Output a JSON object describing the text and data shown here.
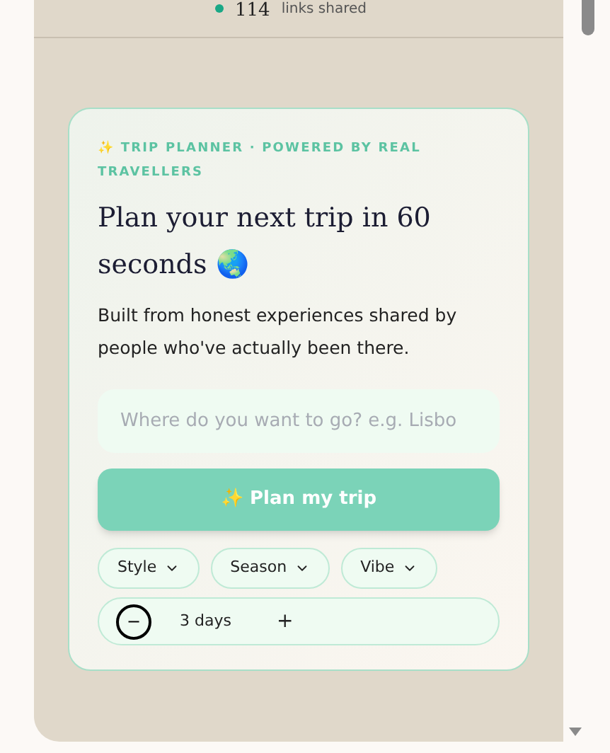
{
  "stat": {
    "value": "114",
    "label": "links shared"
  },
  "planner": {
    "eyebrow_icon": "✨",
    "eyebrow": "TRIP PLANNER · POWERED BY REAL TRAVELLERS",
    "title": "Plan your next trip in 60 seconds",
    "title_emoji": "🌏",
    "description": "Built from honest experiences shared by people who've actually been there.",
    "destination": {
      "placeholder": "Where do you want to go? e.g. Lisbo"
    },
    "submit": {
      "icon": "✨",
      "label": "Plan my trip"
    },
    "filters": [
      {
        "label": "Style"
      },
      {
        "label": "Season"
      },
      {
        "label": "Vibe"
      }
    ],
    "duration": {
      "decrement": "−",
      "value": "3 days",
      "increment": "+"
    }
  }
}
